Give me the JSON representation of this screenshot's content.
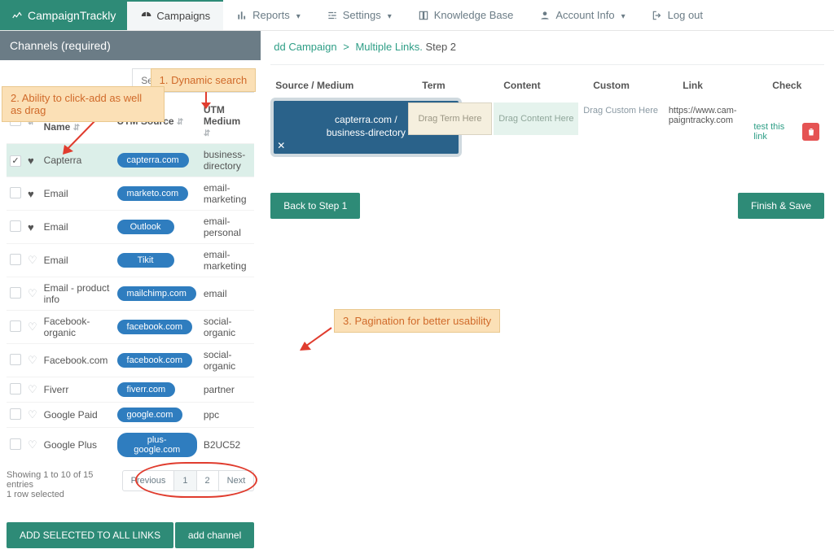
{
  "brand": "CampaignTrackly",
  "nav": {
    "campaigns": "Campaigns",
    "reports": "Reports",
    "settings": "Settings",
    "kb": "Knowledge Base",
    "account": "Account Info",
    "logout": "Log out"
  },
  "left": {
    "title": "Channels (required)",
    "search_placeholder": "Search Channel...",
    "columns": {
      "name": "Channel Name",
      "source": "UTM Source",
      "medium": "UTM Medium"
    },
    "rows": [
      {
        "fav": true,
        "sel": true,
        "name": "Capterra",
        "source": "capterra.com",
        "medium": "business-directory"
      },
      {
        "fav": true,
        "sel": false,
        "name": "Email",
        "source": "marketo.com",
        "medium": "email-marketing"
      },
      {
        "fav": true,
        "sel": false,
        "name": "Email",
        "source": "Outlook",
        "medium": "email-personal"
      },
      {
        "fav": false,
        "sel": false,
        "name": "Email",
        "source": "Tikit",
        "medium": "email-marketing"
      },
      {
        "fav": false,
        "sel": false,
        "name": "Email - product info",
        "source": "mailchimp.com",
        "medium": "email"
      },
      {
        "fav": false,
        "sel": false,
        "name": "Facebook-organic",
        "source": "facebook.com",
        "medium": "social-organic"
      },
      {
        "fav": false,
        "sel": false,
        "name": "Facebook.com",
        "source": "facebook.com",
        "medium": "social-organic"
      },
      {
        "fav": false,
        "sel": false,
        "name": "Fiverr",
        "source": "fiverr.com",
        "medium": "partner"
      },
      {
        "fav": false,
        "sel": false,
        "name": "Google Paid",
        "source": "google.com",
        "medium": "ppc"
      },
      {
        "fav": false,
        "sel": false,
        "name": "Google Plus",
        "source": "plus-google.com",
        "medium": "B2UC52"
      }
    ],
    "info": "Showing 1 to 10 of 15 entries",
    "info2": "1 row selected",
    "pager": {
      "prev": "Previous",
      "p1": "1",
      "p2": "2",
      "next": "Next"
    },
    "add_selected": "ADD SELECTED TO ALL LINKS",
    "add_channel": "add channel"
  },
  "right": {
    "breadcrumb_a": "dd Campaign",
    "breadcrumb_b": "Multiple Links.",
    "breadcrumb_step": "Step 2",
    "cols": {
      "sm": "Source / Medium",
      "term": "Term",
      "content": "Content",
      "custom": "Custom",
      "link": "Link",
      "check": "Check"
    },
    "row": {
      "source": "capterra.com /",
      "medium": "business-directory",
      "term": "Drag Term Here",
      "content": "Drag Content Here",
      "custom": "Drag Custom Here",
      "link": "https://www.cam-paigntracky.com",
      "test": "test this link"
    },
    "back": "Back to Step 1",
    "finish": "Finish & Save"
  },
  "annotations": {
    "a1": "1. Dynamic search",
    "a2": "2. Ability to click-add as well as drag",
    "a3": "3. Pagination for better usability"
  }
}
